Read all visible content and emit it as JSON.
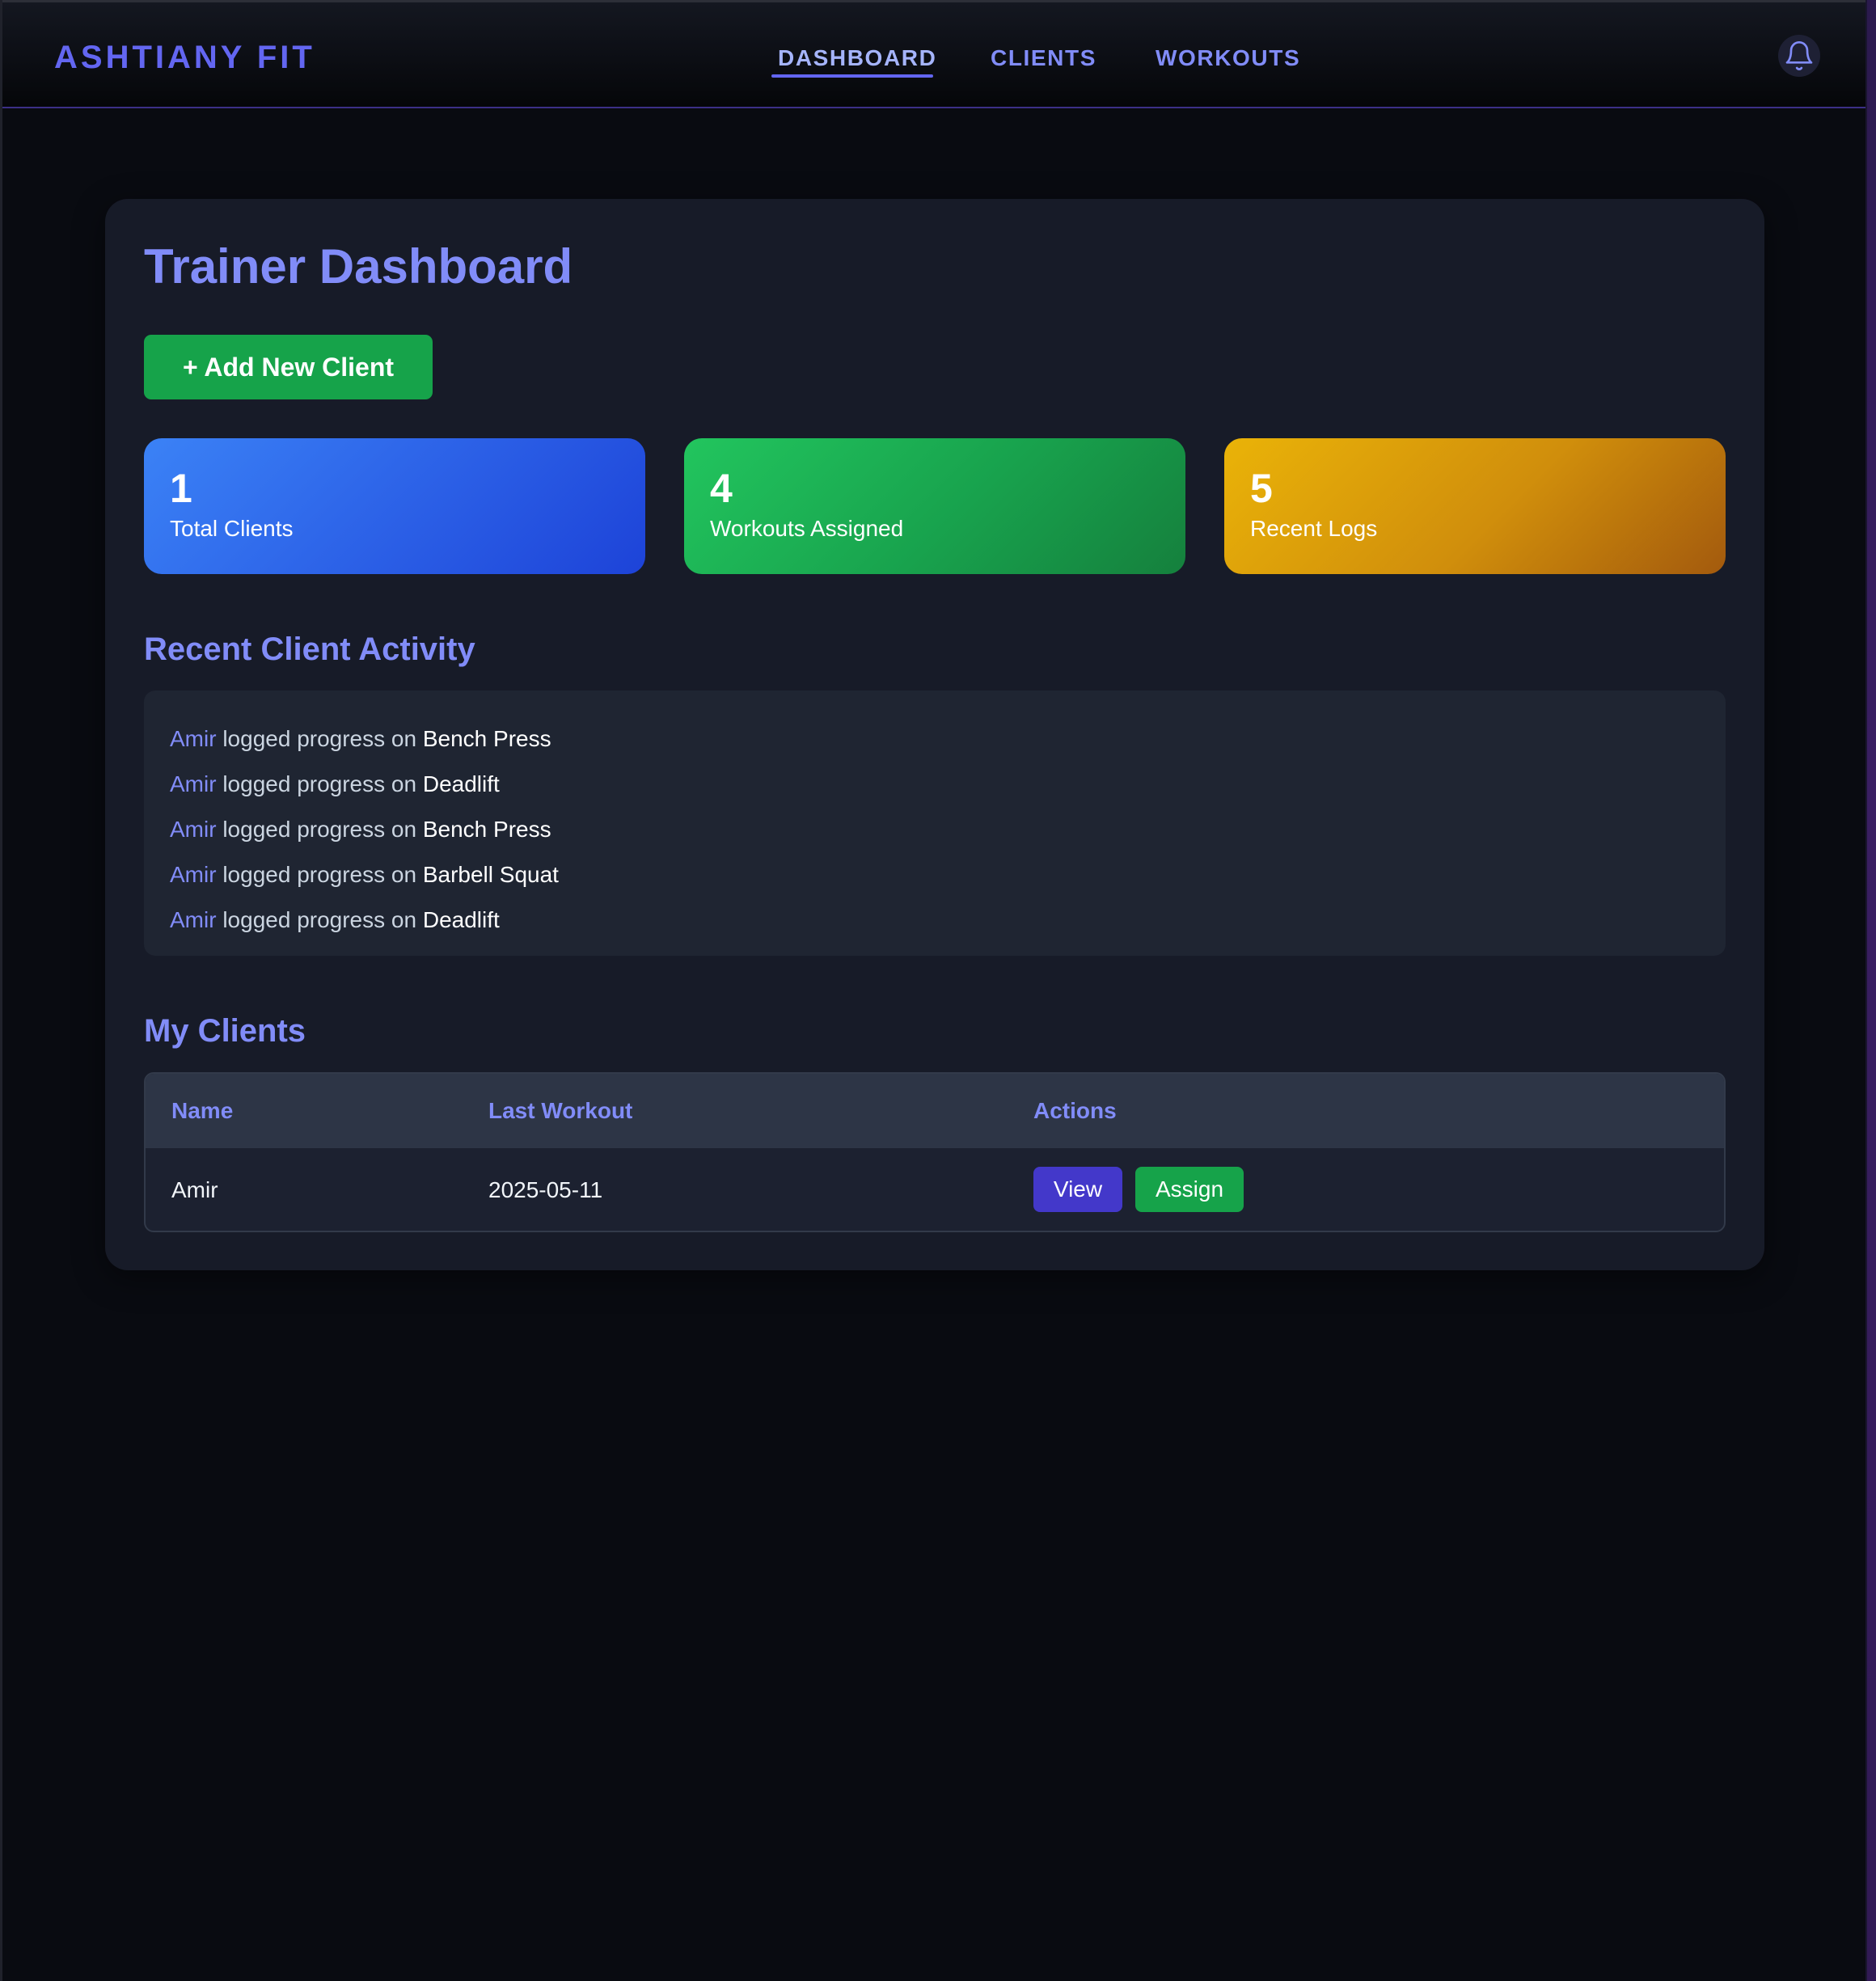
{
  "app": {
    "brand": "ASHTIANY FIT"
  },
  "nav": {
    "items": [
      {
        "label": "DASHBOARD",
        "active": true
      },
      {
        "label": "CLIENTS",
        "active": false
      },
      {
        "label": "WORKOUTS",
        "active": false
      }
    ],
    "notification_icon": "bell-icon"
  },
  "main": {
    "title": "Trainer Dashboard",
    "add_client_label": "+ Add New Client",
    "stats": [
      {
        "value": "1",
        "label": "Total Clients",
        "color": "#2b5fe6"
      },
      {
        "value": "4",
        "label": "Workouts Assigned",
        "color": "#18a24d"
      },
      {
        "value": "5",
        "label": "Recent Logs",
        "color": "#d08e0c"
      }
    ],
    "activity": {
      "title": "Recent Client Activity",
      "connector": "logged progress on",
      "items": [
        {
          "client": "Amir",
          "exercise": "Bench Press"
        },
        {
          "client": "Amir",
          "exercise": "Deadlift"
        },
        {
          "client": "Amir",
          "exercise": "Bench Press"
        },
        {
          "client": "Amir",
          "exercise": "Barbell Squat"
        },
        {
          "client": "Amir",
          "exercise": "Deadlift"
        }
      ]
    },
    "clients": {
      "title": "My Clients",
      "columns": [
        "Name",
        "Last Workout",
        "Actions"
      ],
      "rows": [
        {
          "name": "Amir",
          "last_workout": "2025-05-11",
          "view_label": "View",
          "assign_label": "Assign"
        }
      ]
    }
  },
  "colors": {
    "accent": "#818cf8",
    "brand": "#6366f1",
    "success": "#16a34a",
    "primary_button": "#4338ca",
    "background": "#090b11",
    "panel": "#171b28"
  }
}
